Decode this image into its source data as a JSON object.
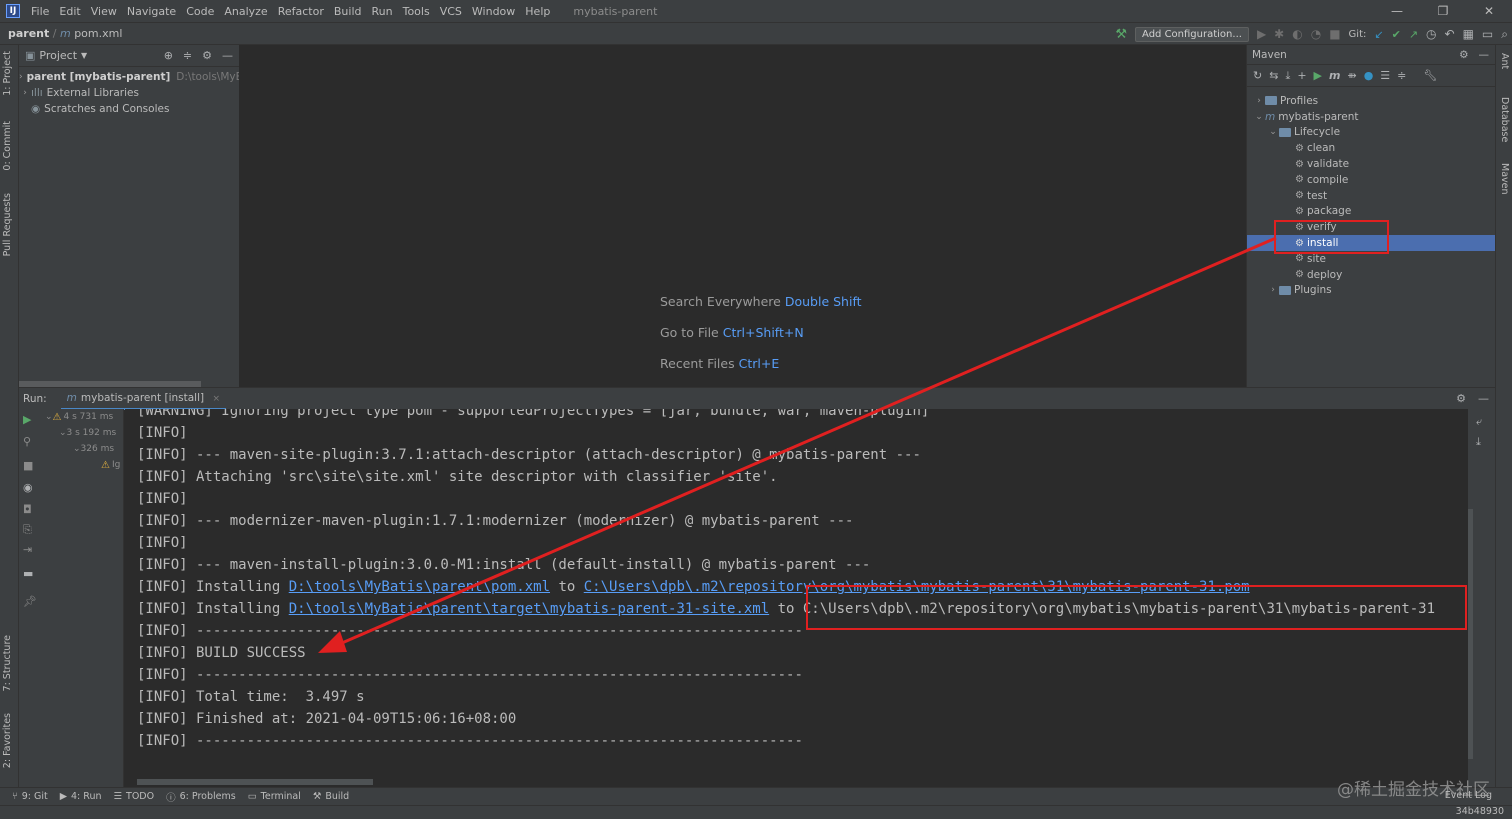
{
  "menubar": {
    "items": [
      "File",
      "Edit",
      "View",
      "Navigate",
      "Code",
      "Analyze",
      "Refactor",
      "Build",
      "Run",
      "Tools",
      "VCS",
      "Window",
      "Help"
    ],
    "project_name": "mybatis-parent"
  },
  "navbar": {
    "project": "parent",
    "file": "pom.xml",
    "add_config": "Add Configuration...",
    "git_label": "Git:"
  },
  "left_strip": {
    "project_tab": "1: Project",
    "commit_tab": "0: Commit",
    "pull_tab": "Pull Requests",
    "structure_tab": "7: Structure",
    "favorites_tab": "2: Favorites"
  },
  "right_strip": {
    "ant_tab": "Ant",
    "database_tab": "Database",
    "maven_tab": "Maven"
  },
  "project_panel": {
    "title": "Project",
    "items": [
      {
        "label": "parent [mybatis-parent]",
        "path": "D:\\tools\\MyBat"
      },
      {
        "label": "External Libraries"
      },
      {
        "label": "Scratches and Consoles"
      }
    ]
  },
  "editor": {
    "hints": [
      {
        "label": "Search Everywhere",
        "key": "Double Shift"
      },
      {
        "label": "Go to File",
        "key": "Ctrl+Shift+N"
      },
      {
        "label": "Recent Files",
        "key": "Ctrl+E"
      }
    ]
  },
  "maven": {
    "title": "Maven",
    "profiles": "Profiles",
    "project": "mybatis-parent",
    "lifecycle": "Lifecycle",
    "goals": [
      "clean",
      "validate",
      "compile",
      "test",
      "package",
      "verify",
      "install",
      "site",
      "deploy"
    ],
    "plugins": "Plugins",
    "selected_goal": "install"
  },
  "run": {
    "label": "Run:",
    "tab": "mybatis-parent [install]",
    "tree": [
      "4 s 731 ms",
      "3 s 192 ms",
      "326 ms",
      "Ig"
    ]
  },
  "console": {
    "lines": [
      "[WARNING] Ignoring project type pom - supportedProjectTypes = [jar, bundle, war, maven-plugin]",
      "[INFO]",
      "[INFO] --- maven-site-plugin:3.7.1:attach-descriptor (attach-descriptor) @ mybatis-parent ---",
      "[INFO] Attaching 'src\\site\\site.xml' site descriptor with classifier 'site'.",
      "[INFO]",
      "[INFO] --- modernizer-maven-plugin:1.7.1:modernizer (modernizer) @ mybatis-parent ---",
      "[INFO]",
      "[INFO] --- maven-install-plugin:3.0.0-M1:install (default-install) @ mybatis-parent ---"
    ],
    "install1_prefix": "[INFO] Installing ",
    "install1_src": "D:\\tools\\MyBatis\\parent\\pom.xml",
    "install1_mid": " to ",
    "install1_dst": "C:\\Users\\dpb\\.m2\\repository\\org\\mybatis\\mybatis-parent\\31\\mybatis-parent-31.pom",
    "install2_prefix": "[INFO] Installing ",
    "install2_src": "D:\\tools\\MyBatis\\parent\\target\\mybatis-parent-31-site.xml",
    "install2_mid": " to ",
    "install2_dst": "C:\\Users\\dpb\\.m2\\repository\\org\\mybatis\\mybatis-parent\\31\\mybatis-parent-31",
    "tail": [
      "[INFO] ------------------------------------------------------------------------",
      "[INFO] BUILD SUCCESS",
      "[INFO] ------------------------------------------------------------------------",
      "[INFO] Total time:  3.497 s",
      "[INFO] Finished at: 2021-04-09T15:06:16+08:00",
      "[INFO] ------------------------------------------------------------------------"
    ]
  },
  "bottom_bar": {
    "tabs": [
      "9: Git",
      "4: Run",
      "TODO",
      "6: Problems",
      "Terminal",
      "Build"
    ],
    "event_log": "Event Log",
    "hash": "34b48930",
    "watermark": "@稀土掘金技术社区"
  },
  "colors": {
    "annotation_red": "#e02020",
    "selection_blue": "#4b6eaf",
    "link_blue": "#589df6"
  }
}
